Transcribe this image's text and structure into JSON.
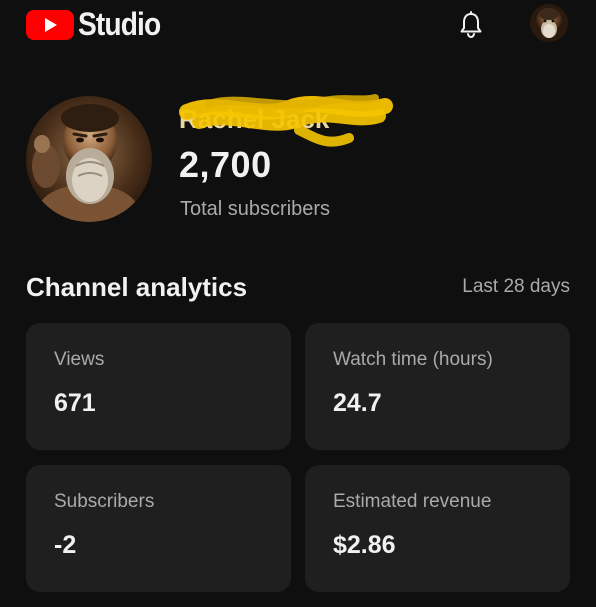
{
  "app": {
    "title": "Studio",
    "logo_icon": "youtube-play-icon",
    "brand_color": "#ff0000"
  },
  "header": {
    "notifications_icon": "bell-icon",
    "account_avatar": "avatar"
  },
  "channel": {
    "name": "Rachel Jack",
    "subscriber_count": "2,700",
    "subscriber_label": "Total subscribers"
  },
  "analytics": {
    "title": "Channel analytics",
    "range": "Last 28 days",
    "cards": [
      {
        "label": "Views",
        "value": "671"
      },
      {
        "label": "Watch time (hours)",
        "value": "24.7"
      },
      {
        "label": "Subscribers",
        "value": "-2"
      },
      {
        "label": "Estimated revenue",
        "value": "$2.86"
      }
    ]
  },
  "colors": {
    "background": "#0f0f0f",
    "card": "#1f1f1f",
    "secondary_text": "#aaaaaa",
    "redaction": "#f5c400"
  }
}
